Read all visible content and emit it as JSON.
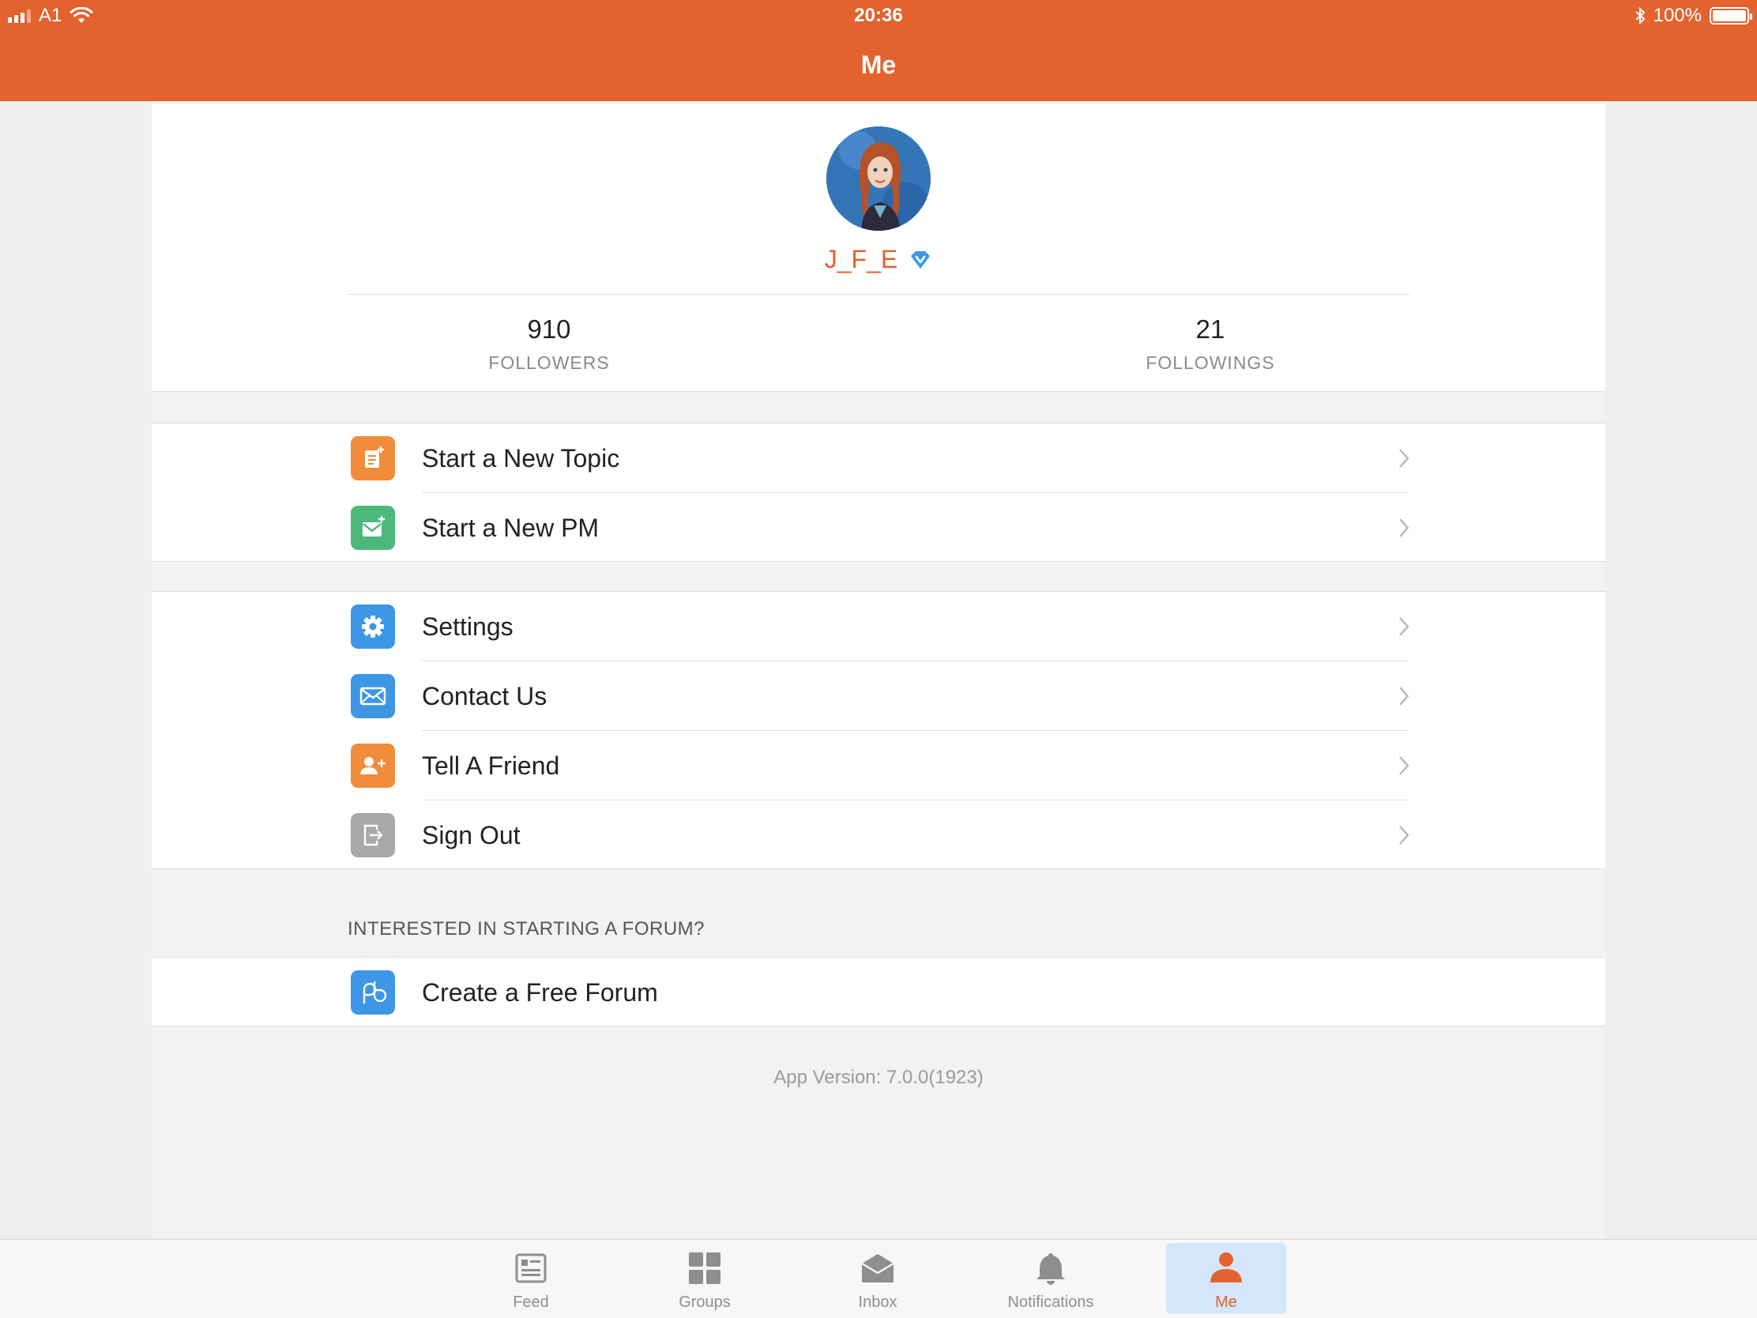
{
  "status_bar": {
    "carrier": "A1",
    "time": "20:36",
    "battery_text": "100%"
  },
  "nav": {
    "title": "Me"
  },
  "profile": {
    "username": "J_F_E",
    "followers_count": "910",
    "followers_label": "FOLLOWERS",
    "followings_count": "21",
    "followings_label": "FOLLOWINGS"
  },
  "actions": [
    {
      "label": "Start a New Topic",
      "icon": "new-topic-icon",
      "color": "#f08c3a"
    },
    {
      "label": "Start a New PM",
      "icon": "new-pm-icon",
      "color": "#4cb87a"
    }
  ],
  "menu": [
    {
      "label": "Settings",
      "icon": "gear-icon",
      "color": "#3d97e6"
    },
    {
      "label": "Contact Us",
      "icon": "envelope-icon",
      "color": "#3d97e6"
    },
    {
      "label": "Tell A Friend",
      "icon": "add-friend-icon",
      "color": "#f08c3a"
    },
    {
      "label": "Sign Out",
      "icon": "sign-out-icon",
      "color": "#a8a8a8"
    }
  ],
  "forum": {
    "header": "INTERESTED IN STARTING A FORUM?",
    "create_label": "Create a Free Forum",
    "icon": "forum-logo-icon",
    "color": "#3d97e6"
  },
  "app_version": "App Version: 7.0.0(1923)",
  "tabs": [
    {
      "label": "Feed",
      "icon": "feed-icon"
    },
    {
      "label": "Groups",
      "icon": "groups-icon"
    },
    {
      "label": "Inbox",
      "icon": "inbox-icon"
    },
    {
      "label": "Notifications",
      "icon": "bell-icon"
    },
    {
      "label": "Me",
      "icon": "person-icon",
      "active": true
    }
  ],
  "colors": {
    "brand": "#e3622e",
    "active_tab_bg": "#d4e6f9",
    "verified": "#3d97e6"
  }
}
